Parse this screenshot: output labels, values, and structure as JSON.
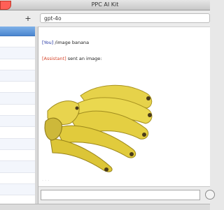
{
  "window": {
    "title": "PPC AI Kit"
  },
  "toolbar": {
    "add_label": "+",
    "model_value": "gpt-4o"
  },
  "sidebar": {
    "rows": 15
  },
  "chat": {
    "user_label": "[You]",
    "user_text": " /image banana",
    "assistant_label": "[Assistant]",
    "assistant_text": " sent an image:",
    "image_subject": "bananas"
  },
  "input": {
    "value": "",
    "placeholder": ""
  }
}
